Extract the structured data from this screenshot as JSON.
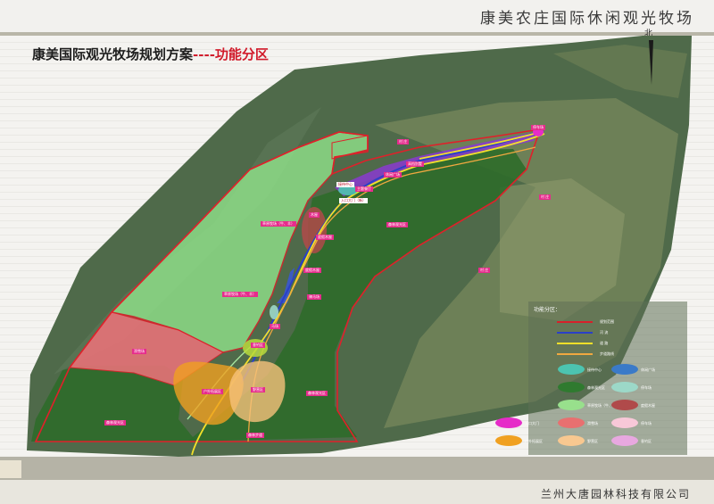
{
  "header": {
    "title": "康美农庄国际休闲观光牧场"
  },
  "plan_title": {
    "main": "康美国际观光牧场规划方案",
    "suffix": "----功能分区"
  },
  "north_label": "北",
  "footer": {
    "company": "兰州大唐园林科技有限公司"
  },
  "map_labels": [
    {
      "text": "接待中心",
      "bg": "#ffffff",
      "color": "#c0102a"
    },
    {
      "text": "主题餐厅",
      "bg": "#e62c8c",
      "color": "#ffffff"
    },
    {
      "text": "入口大门（新）",
      "bg": "#ffffff",
      "color": "#b0102a"
    },
    {
      "text": "休闲广场",
      "bg": "#e62c8c",
      "color": "#ffffff"
    },
    {
      "text": "高档别墅",
      "bg": "#e62c8c",
      "color": "#ffffff"
    },
    {
      "text": "木屋",
      "bg": "#e62c8c",
      "color": "#ffffff"
    },
    {
      "text": "度假木屋",
      "bg": "#e62c8c",
      "color": "#ffffff"
    },
    {
      "text": "度假木屋",
      "bg": "#e62c8c",
      "color": "#ffffff"
    },
    {
      "text": "森林观光区",
      "bg": "#e62c8c",
      "color": "#ffffff"
    },
    {
      "text": "草原牧场（牛、羊）",
      "bg": "#e62c8c",
      "color": "#ffffff"
    },
    {
      "text": "草原牧场（牛、羊）",
      "bg": "#e62c8c",
      "color": "#ffffff"
    },
    {
      "text": "骑马场",
      "bg": "#e62c8c",
      "color": "#ffffff"
    },
    {
      "text": "马场",
      "bg": "#e62c8c",
      "color": "#ffffff"
    },
    {
      "text": "垂钓区",
      "bg": "#e62c8c",
      "color": "#ffffff"
    },
    {
      "text": "滑雪场",
      "bg": "#e62c8c",
      "color": "#ffffff"
    },
    {
      "text": "户外拓展区",
      "bg": "#e62c8c",
      "color": "#ffffff"
    },
    {
      "text": "野营区",
      "bg": "#e62c8c",
      "color": "#ffffff"
    },
    {
      "text": "森林观光区",
      "bg": "#e62c8c",
      "color": "#ffffff"
    },
    {
      "text": "森林观光区",
      "bg": "#e62c8c",
      "color": "#ffffff"
    },
    {
      "text": "森林步道",
      "bg": "#e62c8c",
      "color": "#ffffff"
    },
    {
      "text": "停车场",
      "bg": "#e62c8c",
      "color": "#ffffff"
    },
    {
      "text": "村 庄",
      "bg": "#e62c8c",
      "color": "#ffffff"
    },
    {
      "text": "村 庄",
      "bg": "#e62c8c",
      "color": "#ffffff"
    },
    {
      "text": "村 庄",
      "bg": "#e62c8c",
      "color": "#ffffff"
    }
  ],
  "legend": {
    "title": "功能分区：",
    "lines": [
      {
        "label": "规划范围",
        "color": "#d8202a"
      },
      {
        "label": "河 流",
        "color": "#2a40c8"
      },
      {
        "label": "道 路",
        "color": "#f2e02a"
      },
      {
        "label": "步道路线",
        "color": "#f0a840"
      }
    ],
    "swatches": [
      {
        "label": "接待中心",
        "color": "#4cc4b0"
      },
      {
        "label": "休闲广场",
        "color": "#3a7ac8"
      },
      {
        "label": "森林观光区",
        "color": "#2f7a2f"
      },
      {
        "label": "停车场",
        "color": "#9cd8c8"
      },
      {
        "label": "草原牧场（牛、羊）",
        "color": "#98e08c"
      },
      {
        "label": "度假木屋",
        "color": "#b04a4a"
      },
      {
        "label": "入口大门",
        "color": "#e62cc8"
      },
      {
        "label": "滑雪场",
        "color": "#e87070"
      },
      {
        "label": "停车场",
        "color": "#f8c8d8"
      },
      {
        "label": "户外拓展区",
        "color": "#f0a020"
      },
      {
        "label": "野营区",
        "color": "#f8c890"
      },
      {
        "label": "垂钓区",
        "color": "#e8a8e0"
      }
    ]
  }
}
